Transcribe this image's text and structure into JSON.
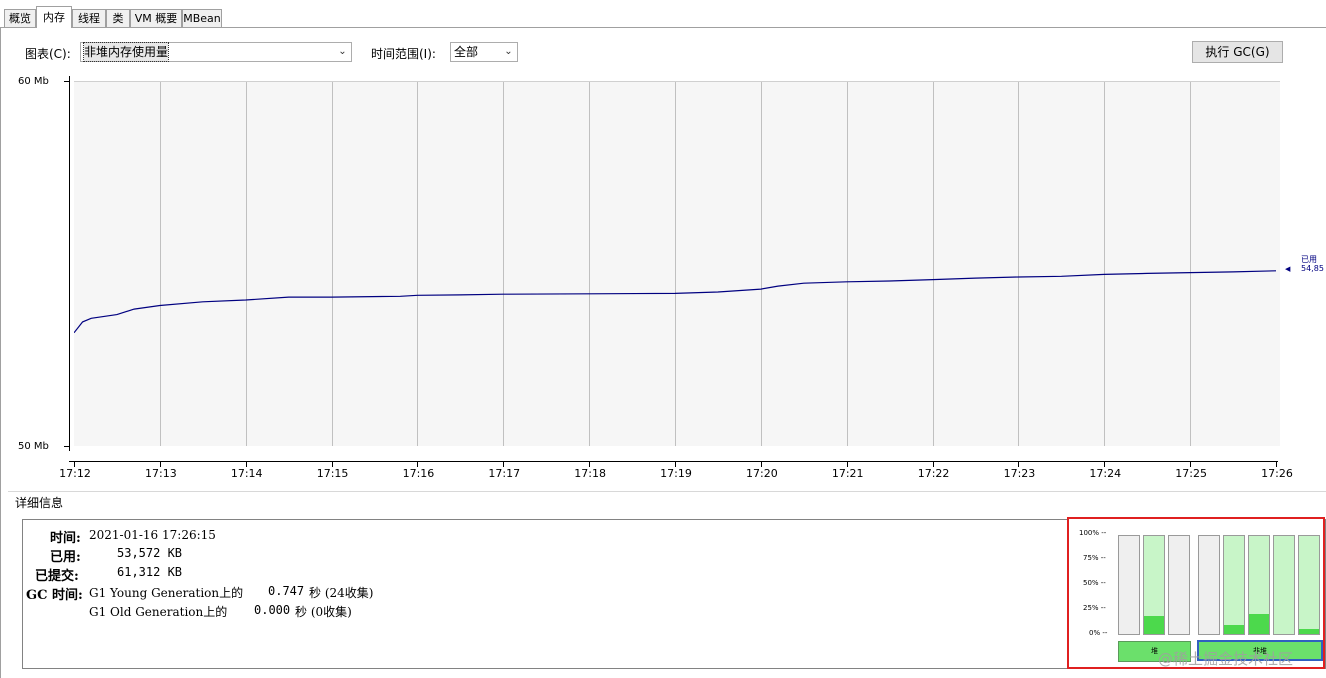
{
  "tabs": [
    {
      "label": "概览",
      "active": false
    },
    {
      "label": "内存",
      "active": true
    },
    {
      "label": "线程",
      "active": false
    },
    {
      "label": "类",
      "active": false
    },
    {
      "label": "VM 概要",
      "active": false
    },
    {
      "label": "MBean",
      "active": false
    }
  ],
  "toolbar": {
    "chart_label": "图表(C):",
    "chart_value": "非堆内存使用量",
    "range_label": "时间范围(I):",
    "range_value": "全部",
    "gc_button": "执行 GC(G)"
  },
  "chart_data": {
    "type": "line",
    "y_unit": "Mb",
    "ylim": [
      50,
      60
    ],
    "y_ticks": [
      "60 Mb",
      "50 Mb"
    ],
    "x_ticks": [
      "17:12",
      "17:13",
      "17:14",
      "17:15",
      "17:16",
      "17:17",
      "17:18",
      "17:19",
      "17:20",
      "17:21",
      "17:22",
      "17:23",
      "17:24",
      "17:25",
      "17:26"
    ],
    "series": [
      {
        "name": "已用",
        "color": "#000080",
        "latest_label": "54,85",
        "x": [
          "17:12",
          "17:12.1",
          "17:12.2",
          "17:12.5",
          "17:12.7",
          "17:13",
          "17:13.5",
          "17:14",
          "17:14.5",
          "17:15",
          "17:15.8",
          "17:16",
          "17:16.5",
          "17:17",
          "17:18",
          "17:19",
          "17:19.5",
          "17:20",
          "17:20.2",
          "17:20.5",
          "17:21",
          "17:21.5",
          "17:22",
          "17:22.5",
          "17:23",
          "17:23.5",
          "17:24",
          "17:24.5",
          "17:25",
          "17:25.5",
          "17:26"
        ],
        "values": [
          53.1,
          53.4,
          53.5,
          53.6,
          53.75,
          53.85,
          53.95,
          54.0,
          54.08,
          54.08,
          54.1,
          54.13,
          54.14,
          54.16,
          54.17,
          54.18,
          54.22,
          54.3,
          54.38,
          54.46,
          54.5,
          54.52,
          54.56,
          54.6,
          54.63,
          54.65,
          54.7,
          54.73,
          54.75,
          54.77,
          54.8
        ]
      }
    ]
  },
  "details": {
    "title": "详细信息",
    "time_key": "时间:",
    "time_val": "2021-01-16 17:26:15",
    "used_key": "已用:",
    "used_val": "53,572 KB",
    "committed_key": "已提交:",
    "committed_val": "61,312 KB",
    "gc_key": "GC 时间:",
    "gc_young_name": "G1 Young Generation上的",
    "gc_young_secs": "0.747",
    "gc_young_unit": "秒 (24收集)",
    "gc_old_name": "G1 Old Generation上的",
    "gc_old_secs": "0.000",
    "gc_old_unit": "秒 (0收集)"
  },
  "pools": {
    "pct_labels": [
      "100% --",
      "75% --",
      "50% --",
      "25% --",
      "0% --"
    ],
    "heap_label": "堆",
    "nonheap_label": "非堆",
    "heap_bars": [
      0.0,
      0.18,
      0.0
    ],
    "nonheap_bars": [
      0.0,
      0.09,
      0.2,
      0.0,
      0.05
    ]
  },
  "watermark": "@稀土掘金技术社区"
}
